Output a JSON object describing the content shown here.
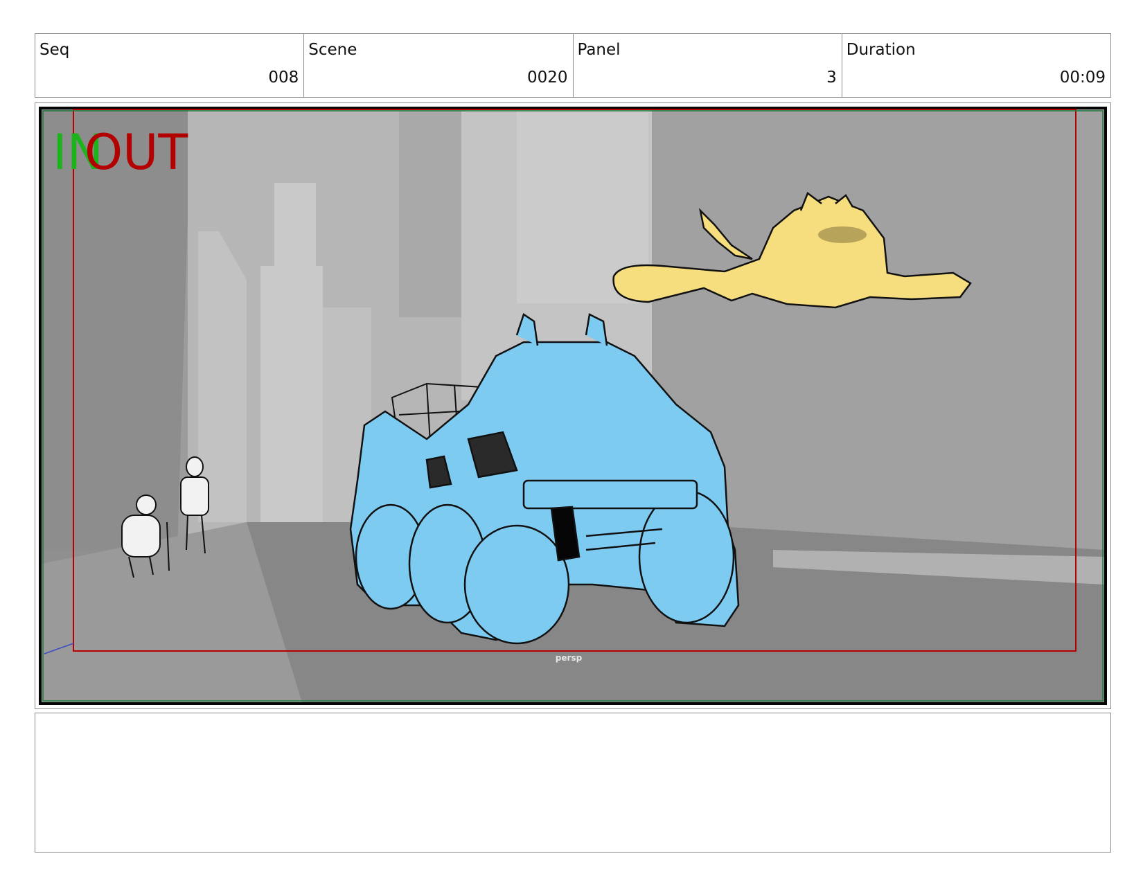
{
  "header": {
    "seq_label": "Seq",
    "seq_value": "008",
    "scene_label": "Scene",
    "scene_value": "0020",
    "panel_label": "Panel",
    "panel_value": "3",
    "duration_label": "Duration",
    "duration_value": "00:09"
  },
  "viewport": {
    "in_label": "IN",
    "out_label": "OUT",
    "camera_label": "persp",
    "in_color": "#1db31d",
    "out_color": "#b30000",
    "vehicle_color": "#7ecbf2",
    "ship_color": "#f6dd7e"
  },
  "notes": {
    "text": ""
  }
}
